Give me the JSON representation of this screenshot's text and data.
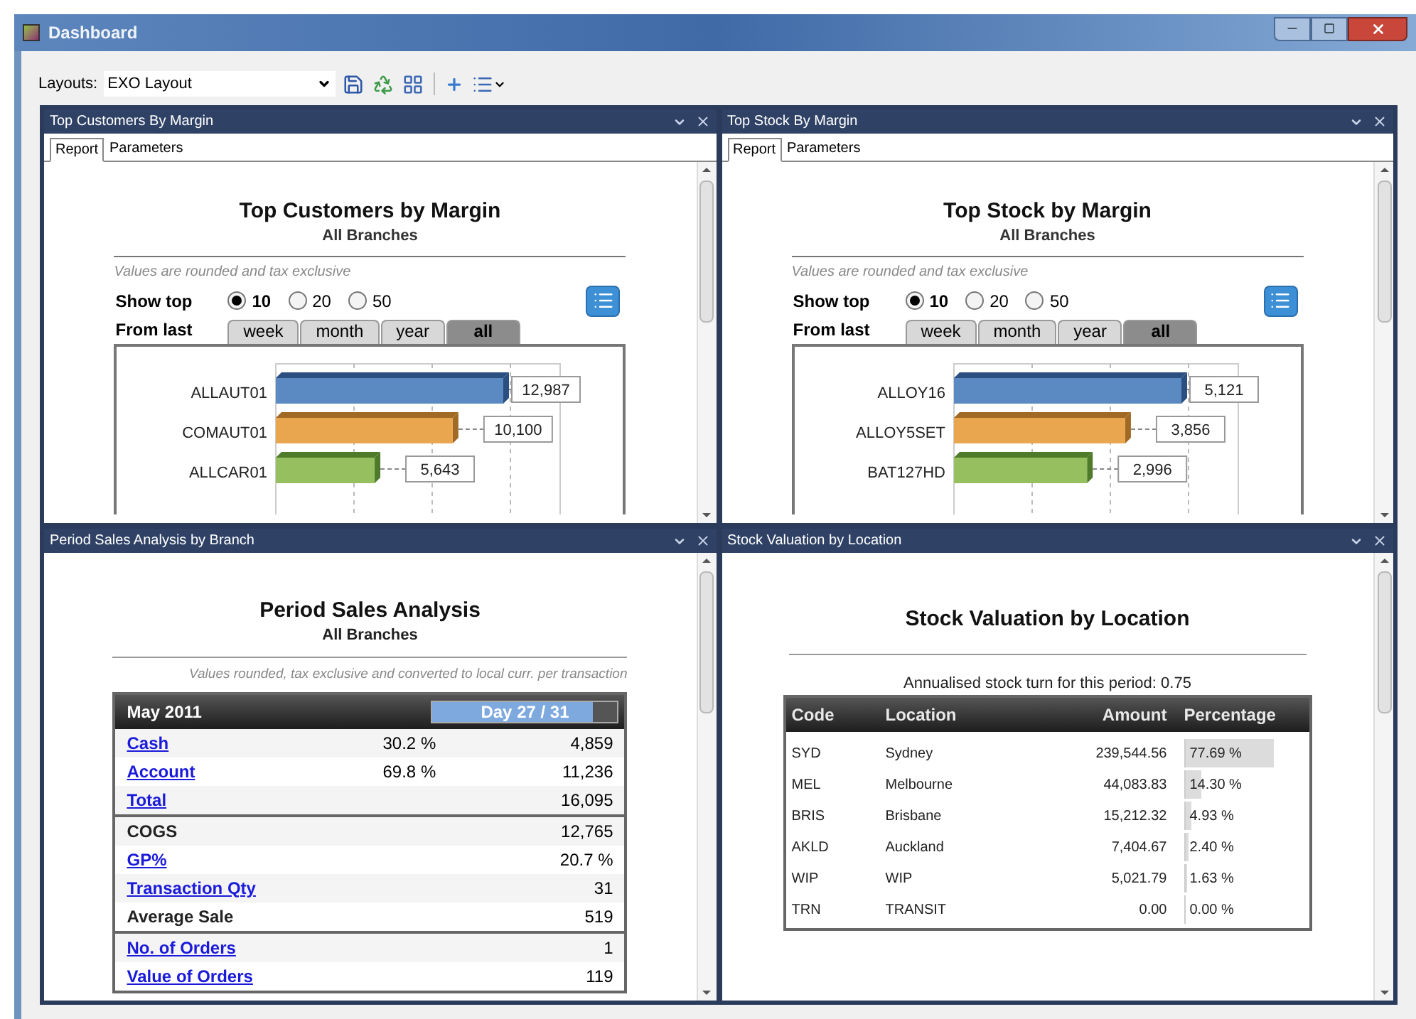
{
  "window": {
    "title": "Dashboard"
  },
  "toolbar": {
    "layouts_label": "Layouts:",
    "layout_value": "EXO Layout"
  },
  "panels": [
    {
      "kind": "top",
      "title": "Top Customers By Margin",
      "tabs": [
        {
          "label": "Report",
          "selected": true
        },
        {
          "label": "Parameters",
          "selected": false
        }
      ],
      "heading": "Top Customers by Margin",
      "subheading": "All Branches",
      "note": "Values are rounded and tax exclusive",
      "show_top_label": "Show top",
      "show_top_options": [
        {
          "label": "10",
          "selected": true
        },
        {
          "label": "20",
          "selected": false
        },
        {
          "label": "50",
          "selected": false
        }
      ],
      "from_last_label": "From last",
      "periods": [
        {
          "label": "week",
          "selected": false
        },
        {
          "label": "month",
          "selected": false
        },
        {
          "label": "year",
          "selected": false
        },
        {
          "label": "all",
          "selected": true
        }
      ],
      "chart_data": {
        "type": "bar",
        "orientation": "horizontal",
        "categories": [
          "ALLAUT01",
          "COMAUT01",
          "ALLCAR01"
        ],
        "values": [
          12987,
          10100,
          5643
        ],
        "value_labels": [
          "12,987",
          "10,100",
          "5,643"
        ]
      }
    },
    {
      "kind": "top",
      "title": "Top Stock By Margin",
      "tabs": [
        {
          "label": "Report",
          "selected": true
        },
        {
          "label": "Parameters",
          "selected": false
        }
      ],
      "heading": "Top Stock by Margin",
      "subheading": "All Branches",
      "note": "Values are rounded and tax exclusive",
      "show_top_label": "Show top",
      "show_top_options": [
        {
          "label": "10",
          "selected": true
        },
        {
          "label": "20",
          "selected": false
        },
        {
          "label": "50",
          "selected": false
        }
      ],
      "from_last_label": "From last",
      "periods": [
        {
          "label": "week",
          "selected": false
        },
        {
          "label": "month",
          "selected": false
        },
        {
          "label": "year",
          "selected": false
        },
        {
          "label": "all",
          "selected": true
        }
      ],
      "chart_data": {
        "type": "bar",
        "orientation": "horizontal",
        "categories": [
          "ALLOY16",
          "ALLOY5SET",
          "BAT127HD"
        ],
        "values": [
          5121,
          3856,
          2996
        ],
        "value_labels": [
          "5,121",
          "3,856",
          "2,996"
        ]
      }
    },
    {
      "kind": "sales",
      "title": "Period Sales Analysis by Branch",
      "heading": "Period Sales Analysis",
      "subheading": "All Branches",
      "note": "Values rounded, tax exclusive and converted to local curr. per transaction",
      "month": "May 2011",
      "day": {
        "label": "Day 27 / 31",
        "level": 0.871
      },
      "groups": [
        [
          {
            "label": "Cash",
            "link": true,
            "percent": "30.2 %",
            "value": "4,859"
          },
          {
            "label": "Account",
            "link": true,
            "percent": "69.8 %",
            "value": "11,236"
          },
          {
            "label": "Total",
            "link": true,
            "value": "16,095"
          }
        ],
        [
          {
            "label": "COGS",
            "link": false,
            "value": "12,765"
          },
          {
            "label": "GP%",
            "link": true,
            "value": "20.7 %"
          },
          {
            "label": "Transaction Qty",
            "link": true,
            "value": "31"
          },
          {
            "label": "Average Sale",
            "link": false,
            "value": "519"
          }
        ],
        [
          {
            "label": "No. of Orders",
            "link": true,
            "value": "1"
          },
          {
            "label": "Value of Orders",
            "link": true,
            "value": "119"
          }
        ]
      ]
    },
    {
      "kind": "valuation",
      "title": "Stock Valuation by Location",
      "heading": "Stock Valuation by Location",
      "turn": "Annualised stock turn for this period: 0.75",
      "columns": [
        "Code",
        "Location",
        "Amount",
        "Percentage"
      ],
      "rows": [
        {
          "code": "SYD",
          "location": "Sydney",
          "amount": "239,544.56",
          "percentage": "77.69 %",
          "level": 0.7769
        },
        {
          "code": "MEL",
          "location": "Melbourne",
          "amount": "44,083.83",
          "percentage": "14.30 %",
          "level": 0.143
        },
        {
          "code": "BRIS",
          "location": "Brisbane",
          "amount": "15,212.32",
          "percentage": "4.93 %",
          "level": 0.0493
        },
        {
          "code": "AKLD",
          "location": "Auckland",
          "amount": "7,404.67",
          "percentage": "2.40 %",
          "level": 0.024
        },
        {
          "code": "WIP",
          "location": "WIP",
          "amount": "5,021.79",
          "percentage": "1.63 %",
          "level": 0.0163
        },
        {
          "code": "TRN",
          "location": "TRANSIT",
          "amount": "0.00",
          "percentage": "0.00 %"
        }
      ]
    }
  ]
}
